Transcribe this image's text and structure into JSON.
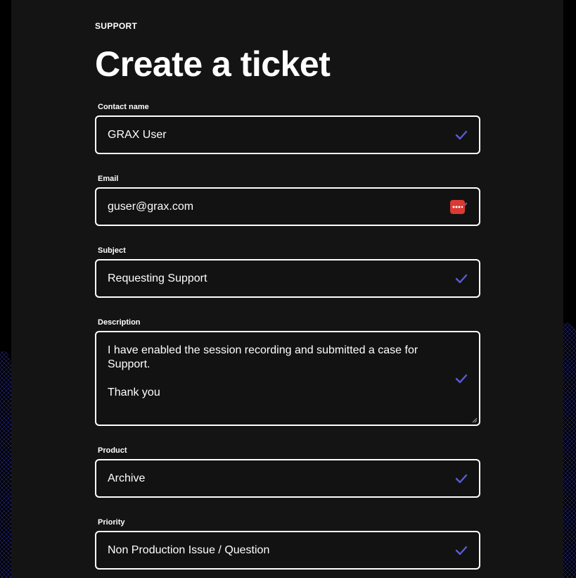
{
  "header": {
    "eyebrow": "SUPPORT",
    "title": "Create a ticket"
  },
  "form": {
    "contact_name": {
      "label": "Contact name",
      "value": "GRAX User",
      "valid": true
    },
    "email": {
      "label": "Email",
      "value": "guser@grax.com",
      "valid": true
    },
    "subject": {
      "label": "Subject",
      "value": "Requesting Support",
      "valid": true
    },
    "description": {
      "label": "Description",
      "line1": "I have enabled the session recording and submitted a case for Support.",
      "line2": "Thank you",
      "valid": true
    },
    "product": {
      "label": "Product",
      "value": "Archive",
      "valid": true
    },
    "priority": {
      "label": "Priority",
      "value": "Non Production Issue / Question",
      "valid": true
    }
  },
  "colors": {
    "page_bg": "#000000",
    "panel_bg": "#141414",
    "border": "#ffffff",
    "check": "#5b5bd6",
    "password_manager_icon": "#d93a33"
  },
  "icons": {
    "valid": "checkmark-icon",
    "password_manager": "password-manager-icon"
  }
}
